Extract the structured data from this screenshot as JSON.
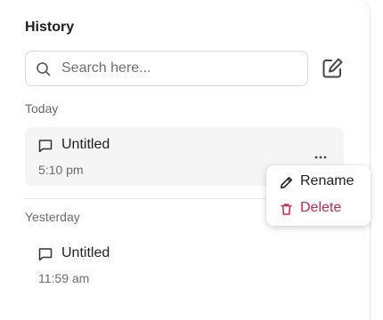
{
  "header": {
    "title": "History"
  },
  "search": {
    "placeholder": "Search here...",
    "value": ""
  },
  "icons": {
    "search": "search-icon",
    "new_chat": "edit-square-icon",
    "chat": "message-square-icon",
    "more": "more-horizontal-icon",
    "rename": "pencil-icon",
    "delete": "trash-icon"
  },
  "sections": [
    {
      "label": "Today",
      "items": [
        {
          "title": "Untitled",
          "time": "5:10 pm",
          "active": true
        }
      ]
    },
    {
      "label": "Yesterday",
      "items": [
        {
          "title": "Untitled",
          "time": "11:59 am",
          "active": false
        }
      ]
    }
  ],
  "context_menu": {
    "rename_label": "Rename",
    "delete_label": "Delete"
  },
  "colors": {
    "delete": "#e11d48",
    "active_item_bg": "#f5f5f5",
    "muted_text": "#6b6b6b"
  }
}
